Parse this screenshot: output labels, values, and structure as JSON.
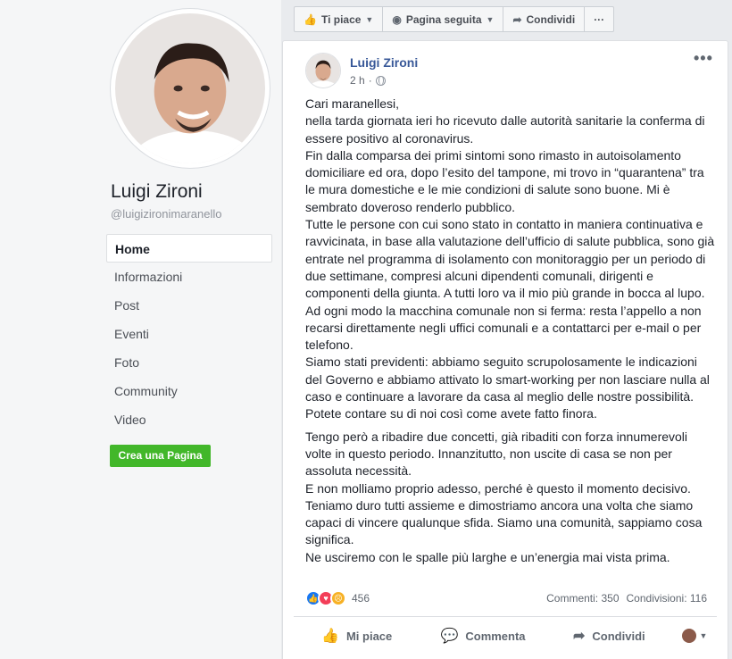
{
  "sidebar": {
    "page_name": "Luigi Zironi",
    "handle": "@luigizironimaranello",
    "nav": [
      {
        "label": "Home",
        "active": true
      },
      {
        "label": "Informazioni"
      },
      {
        "label": "Post"
      },
      {
        "label": "Eventi"
      },
      {
        "label": "Foto"
      },
      {
        "label": "Community"
      },
      {
        "label": "Video"
      }
    ],
    "create_page_label": "Crea una Pagina"
  },
  "actionbar": {
    "like_label": "Ti piace",
    "follow_label": "Pagina seguita",
    "share_label": "Condividi",
    "more_label": "···"
  },
  "post": {
    "author": "Luigi Zironi",
    "time": "2 h",
    "more_label": "•••",
    "paragraphs": [
      "Cari maranellesi,",
      "nella tarda giornata ieri ho ricevuto dalle autorità sanitarie la conferma di essere positivo al coronavirus.",
      "Fin dalla comparsa dei primi sintomi sono rimasto in autoisolamento domiciliare ed ora, dopo l’esito del tampone, mi trovo in “quarantena” tra le mura domestiche e le mie condizioni di salute sono buone. Mi è sembrato doveroso renderlo pubblico.",
      "Tutte le persone con cui sono stato in contatto in maniera continuativa e ravvicinata, in base alla valutazione dell’ufficio di salute pubblica, sono già entrate nel programma di isolamento con monitoraggio per un periodo di due settimane, compresi alcuni dipendenti comunali, dirigenti e componenti della giunta. A tutti loro va il mio più grande in bocca al lupo.",
      "Ad ogni modo la macchina comunale non si ferma: resta l’appello a non recarsi direttamente negli uffici comunali e a contattarci per e-mail o per telefono.",
      "Siamo stati previdenti: abbiamo seguito scrupolosamente le indicazioni del Governo e abbiamo attivato lo smart-working per non lasciare nulla al caso e continuare a lavorare da casa al meglio delle nostre possibilità. Potete contare su di noi così come avete fatto finora.",
      "Tengo però a ribadire due concetti, già ribaditi con forza innumerevoli volte in questo periodo. Innanzitutto, non uscite di casa se non per assoluta necessità.",
      "E non molliamo proprio adesso, perché è questo il momento decisivo.",
      "Teniamo duro tutti assieme e dimostriamo ancora una volta che siamo capaci di vincere qualunque sfida. Siamo una comunità, sappiamo cosa significa.",
      "Ne usciremo con le spalle più larghe e un’energia mai vista prima."
    ],
    "reaction_count": "456",
    "comments": "Commenti: 350",
    "shares": "Condivisioni: 116",
    "btn_like": "Mi piace",
    "btn_comment": "Commenta",
    "btn_share": "Condividi"
  }
}
